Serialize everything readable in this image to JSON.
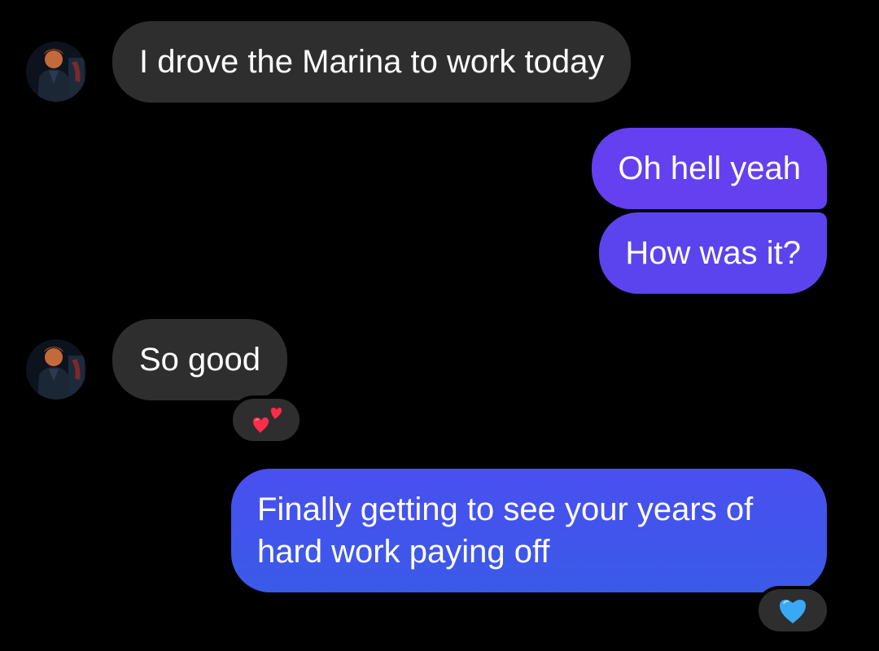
{
  "conversation": {
    "messages": [
      {
        "direction": "incoming",
        "text": "I drove the Marina to work today",
        "avatar": "contact-photo"
      },
      {
        "direction": "outgoing",
        "text": "Oh hell yeah"
      },
      {
        "direction": "outgoing",
        "text": "How was it?"
      },
      {
        "direction": "incoming",
        "text": "So good",
        "avatar": "contact-photo",
        "reaction": "two-hearts-icon"
      },
      {
        "direction": "outgoing",
        "text": "Finally getting to see your years of hard work paying off",
        "reaction": "blue-heart-icon"
      }
    ]
  },
  "colors": {
    "background": "#000000",
    "incoming_bubble": "#2e2e2e",
    "outgoing_gradient": [
      "#6a3ef0",
      "#3a5ae8"
    ],
    "text": "#ffffff"
  }
}
